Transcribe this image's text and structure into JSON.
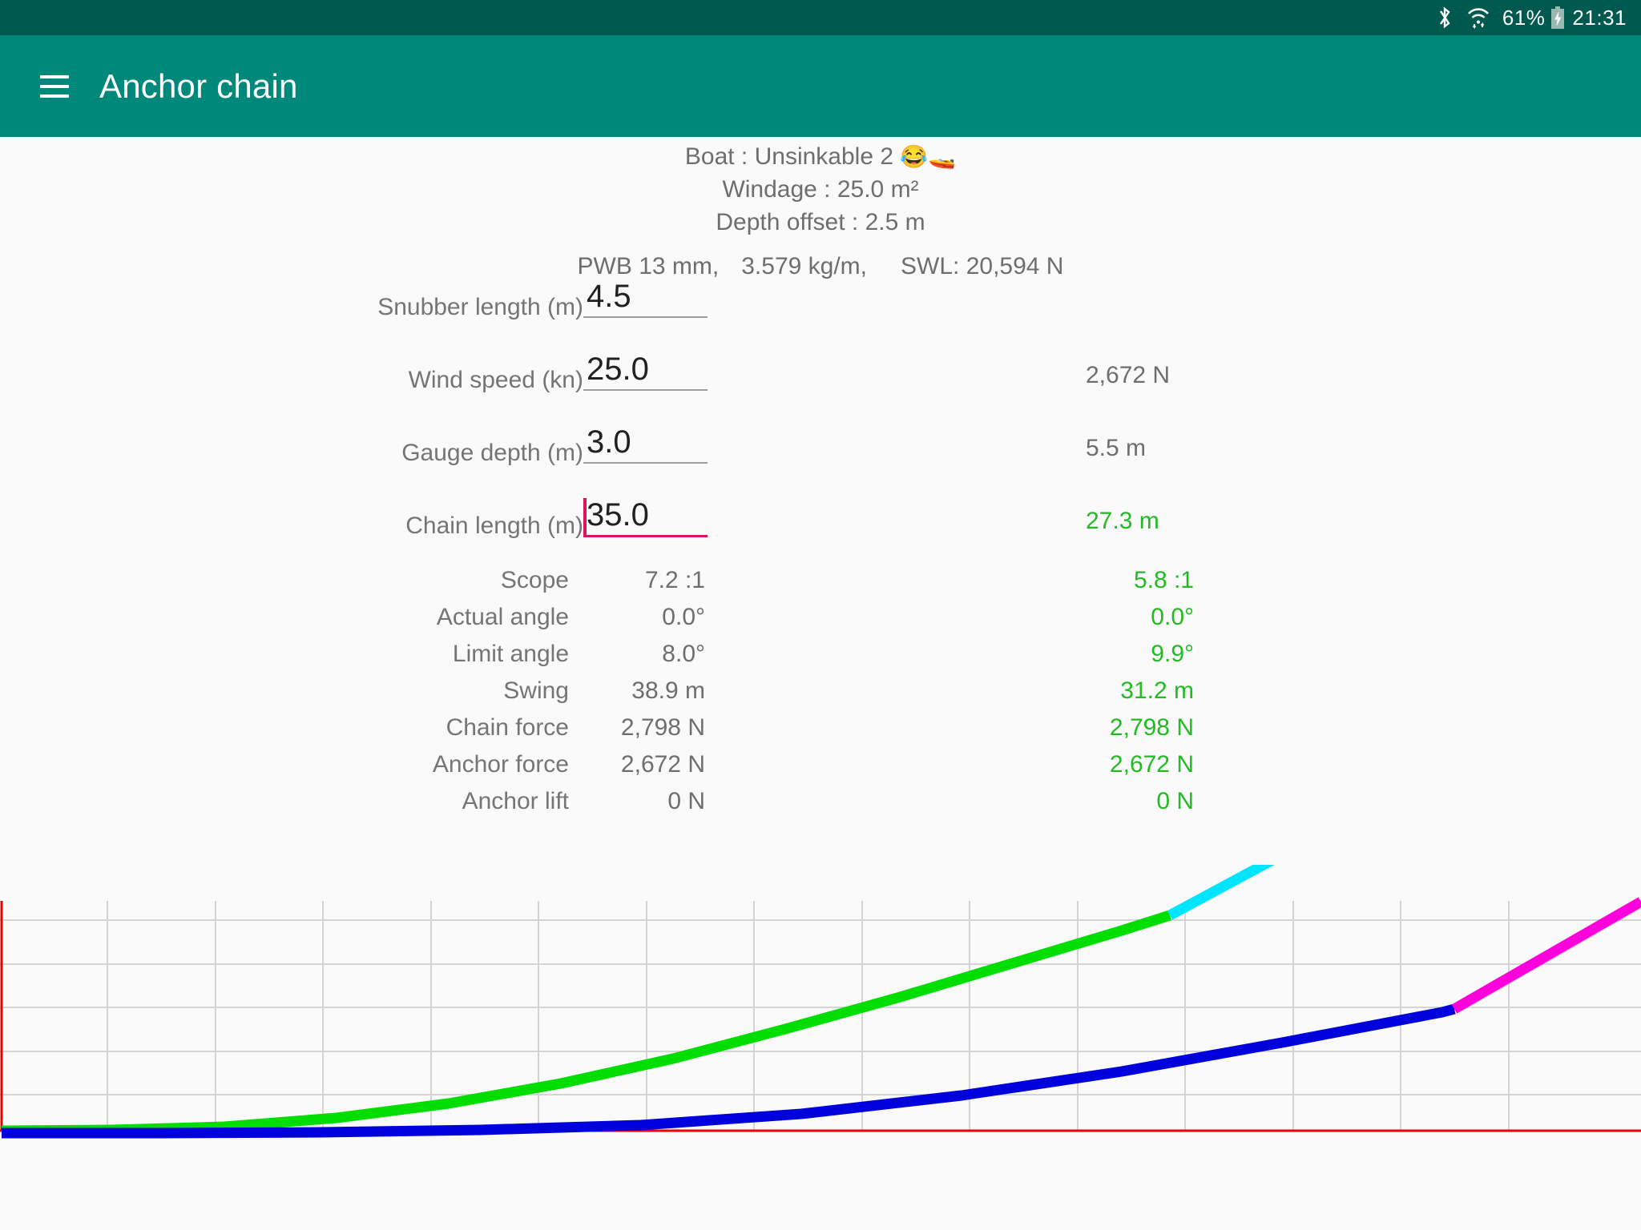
{
  "statusbar": {
    "bluetooth_icon": "bluetooth-icon",
    "wifi_icon": "wifi-icon",
    "battery_percent": "61%",
    "battery_icon": "battery-charging-icon",
    "clock": "21:31"
  },
  "appbar": {
    "menu_icon": "hamburger-menu-icon",
    "title": "Anchor chain"
  },
  "summary": {
    "boat_label": "Boat : Unsinkable 2",
    "boat_emoji_1": "😂",
    "boat_emoji_2": "🚤",
    "windage": "Windage : 25.0 m²",
    "depth_offset": "Depth offset :   2.5 m",
    "chain_spec": "PWB 13 mm,",
    "chain_weight": "3.579 kg/m,",
    "chain_swl": "SWL: 20,594 N"
  },
  "inputs": [
    {
      "label": "Snubber length (m)",
      "value": "4.5",
      "focused": false,
      "result": ""
    },
    {
      "label": "Wind speed (kn)",
      "value": "25.0",
      "focused": false,
      "result": "2,672 N",
      "result_green": false
    },
    {
      "label": "Gauge depth (m)",
      "value": "3.0",
      "focused": false,
      "result": "5.5 m",
      "result_green": false
    },
    {
      "label": "Chain length (m)",
      "value": "35.0",
      "focused": true,
      "result": "27.3 m",
      "result_green": true
    }
  ],
  "results": [
    {
      "label": "Scope",
      "value": "7.2 :1",
      "value2": "5.8 :1"
    },
    {
      "label": "Actual angle",
      "value": "0.0°",
      "value2": "0.0°"
    },
    {
      "label": "Limit angle",
      "value": "8.0°",
      "value2": "9.9°"
    },
    {
      "label": "Swing",
      "value": "38.9 m",
      "value2": "31.2 m"
    },
    {
      "label": "Chain force",
      "value": "2,798 N",
      "value2": "2,798 N"
    },
    {
      "label": "Anchor force",
      "value": "2,672 N",
      "value2": "2,672 N"
    },
    {
      "label": "Anchor lift",
      "value": "0 N",
      "value2": "0 N"
    }
  ],
  "colors": {
    "appbar": "#00897b",
    "statusbar": "#00594f",
    "focus_accent": "#e0115f",
    "result_green": "#22bb22",
    "chain_catenary_a": "#00dd00",
    "chain_catenary_b": "#0000dd",
    "snubber_a": "#00e5ff",
    "snubber_b": "#ff00dd",
    "seabed_line": "#ee0000",
    "grid": "#d4d4d4"
  },
  "chart_data": {
    "type": "line",
    "title": "",
    "xlabel": "",
    "ylabel": "",
    "grid": true,
    "legend": "none",
    "xlim": [
      0,
      2048
    ],
    "ylim": [
      0,
      332
    ],
    "axis_pixels": {
      "left_axis_x": 2,
      "baseline_y": 332,
      "top_y": 45,
      "vgrid_x": [
        134,
        269,
        403,
        538,
        672,
        807,
        941,
        1076,
        1210,
        1345,
        1479,
        1614,
        1748,
        1883
      ],
      "hgrid_y": [
        69,
        124,
        178,
        233,
        287
      ]
    },
    "series": [
      {
        "name": "chain-catenary-green",
        "color": "#00dd00",
        "points": [
          [
            2,
            332
          ],
          [
            140,
            331
          ],
          [
            280,
            327
          ],
          [
            420,
            316
          ],
          [
            560,
            298
          ],
          [
            700,
            273
          ],
          [
            840,
            242
          ],
          [
            980,
            205
          ],
          [
            1120,
            166
          ],
          [
            1260,
            124
          ],
          [
            1400,
            82
          ],
          [
            1460,
            63
          ]
        ]
      },
      {
        "name": "snubber-cyan",
        "color": "#00e5ff",
        "points": [
          [
            1460,
            63
          ],
          [
            1640,
            -34
          ]
        ]
      },
      {
        "name": "chain-catenary-blue",
        "color": "#0000dd",
        "points": [
          [
            2,
            335
          ],
          [
            200,
            335
          ],
          [
            400,
            334
          ],
          [
            600,
            331
          ],
          [
            800,
            325
          ],
          [
            1000,
            311
          ],
          [
            1200,
            288
          ],
          [
            1400,
            258
          ],
          [
            1600,
            222
          ],
          [
            1800,
            184
          ],
          [
            1815,
            180
          ]
        ]
      },
      {
        "name": "snubber-magenta",
        "color": "#ff00dd",
        "points": [
          [
            1815,
            180
          ],
          [
            2048,
            46
          ]
        ]
      },
      {
        "name": "seabed",
        "color": "#ee0000",
        "points": [
          [
            0,
            332
          ],
          [
            2048,
            332
          ]
        ]
      }
    ]
  }
}
